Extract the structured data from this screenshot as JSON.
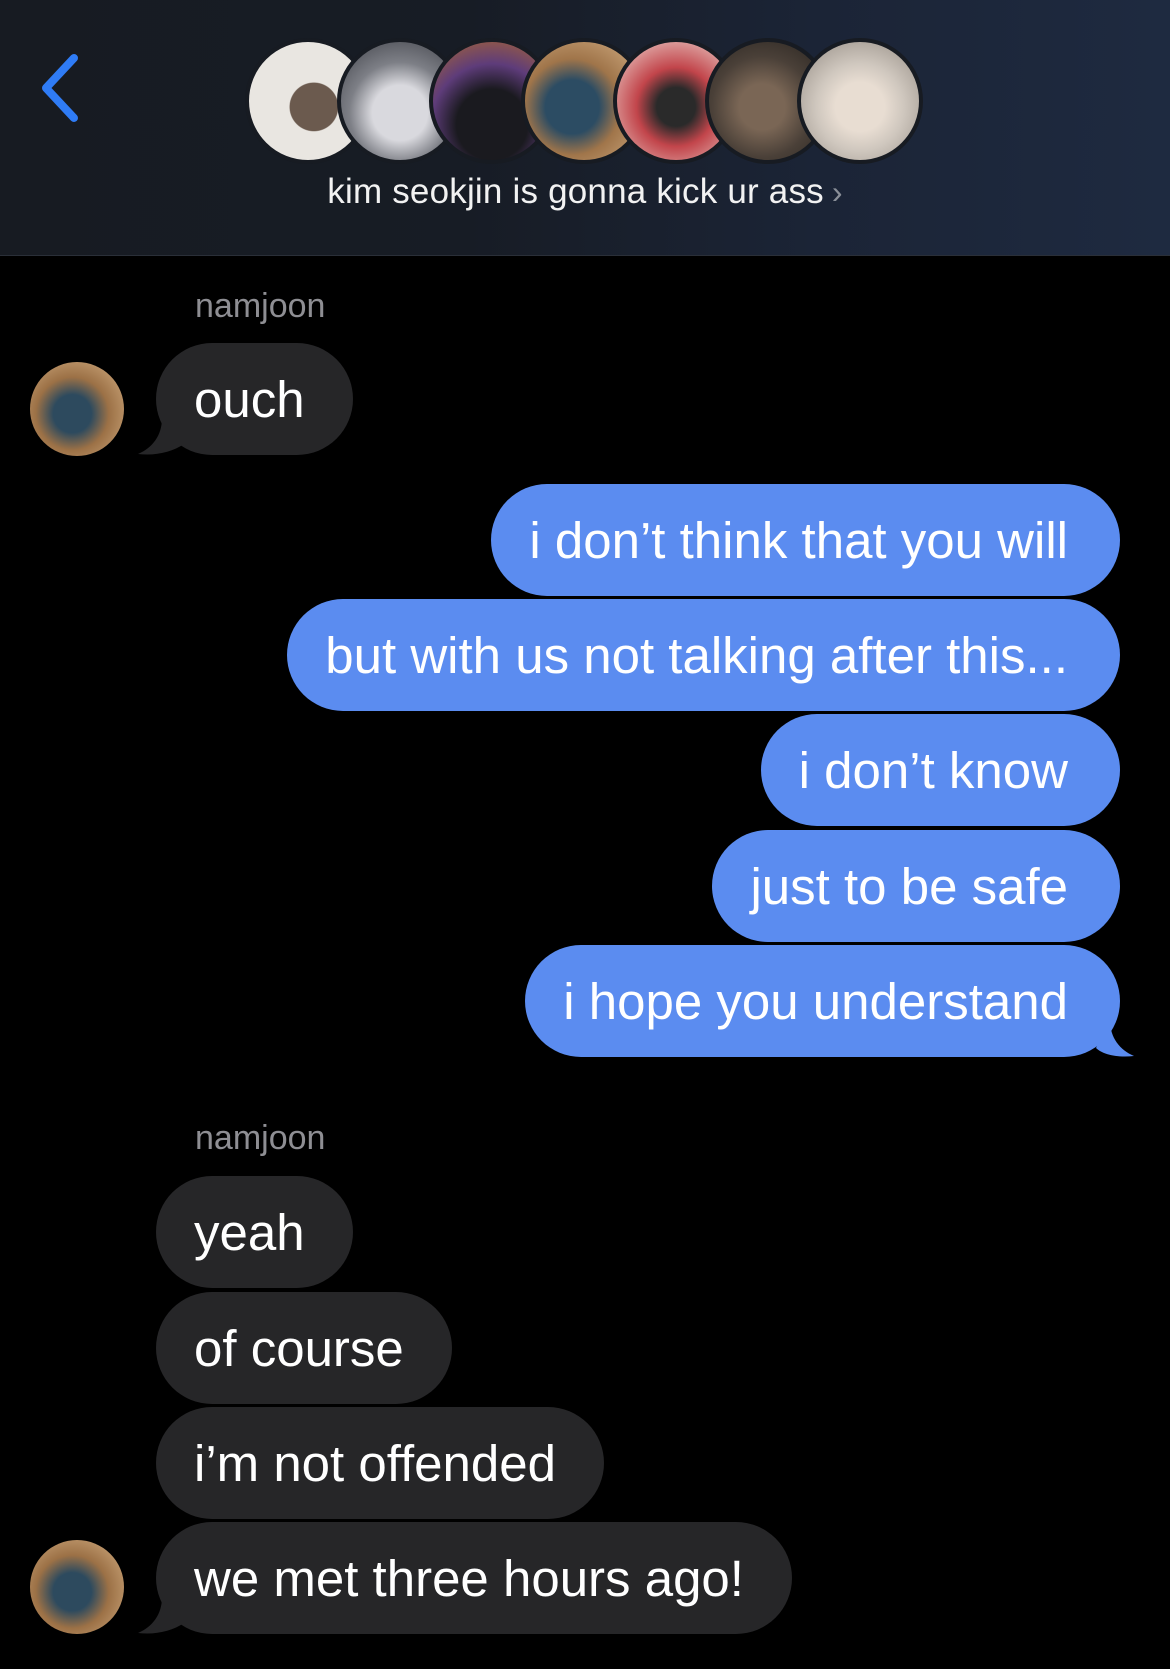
{
  "header": {
    "group_name": "kim seokjin is gonna kick ur ass",
    "chevron": "›",
    "back_icon": "chevron-left-icon",
    "accent": "#2f7cf6",
    "member_avatar_count": 7
  },
  "colors": {
    "outgoing_bubble": "#5b8cf0",
    "incoming_bubble": "#262628",
    "background": "#000000"
  },
  "messages": {
    "group1": {
      "sender": "namjoon",
      "m1": "ouch"
    },
    "outgoing": {
      "m1": "i don’t think that you will",
      "m2": "but with us not talking after this...",
      "m3": "i don’t know",
      "m4": "just to be safe",
      "m5": "i hope you understand"
    },
    "group2": {
      "sender": "namjoon",
      "m1": "yeah",
      "m2": "of course",
      "m3": "i’m not offended",
      "m4": "we met three hours ago!"
    }
  }
}
